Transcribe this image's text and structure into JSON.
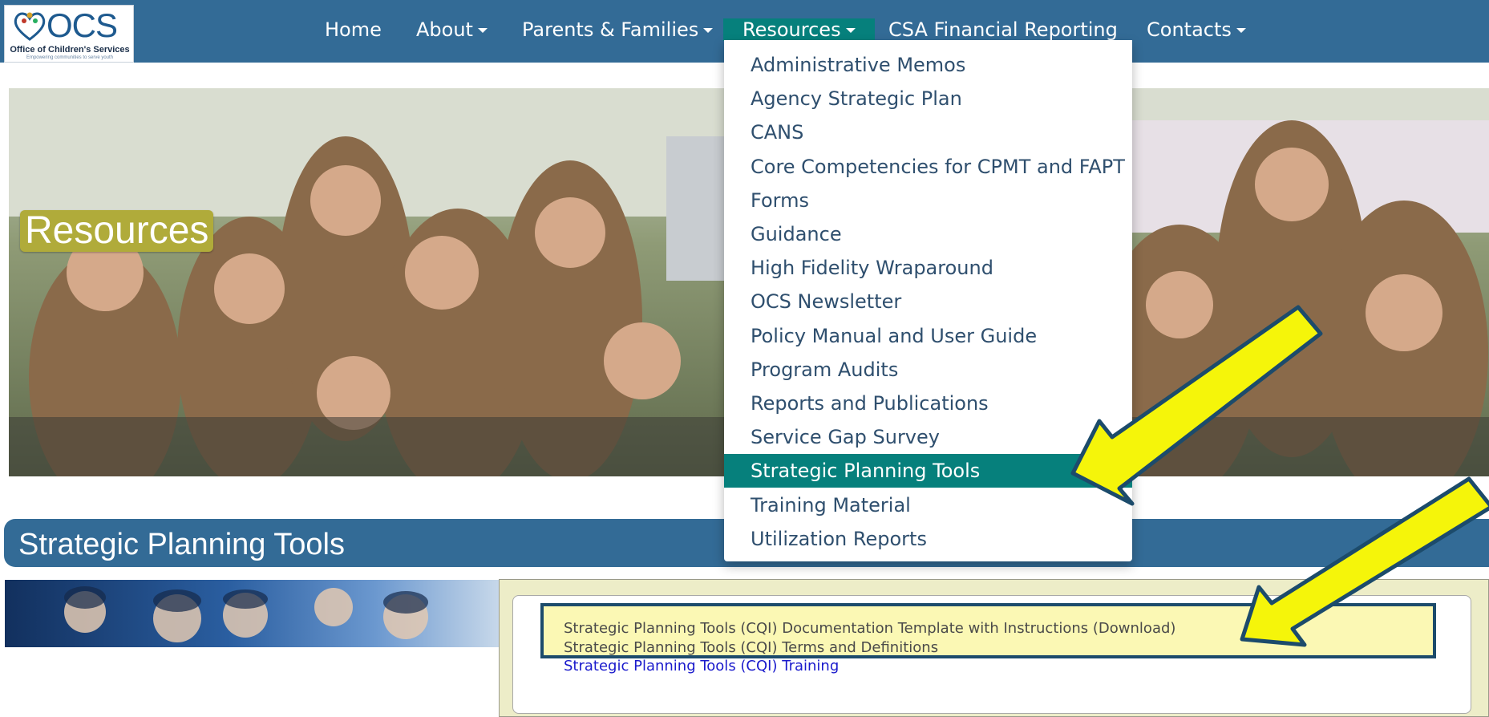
{
  "logo": {
    "name": "OCS",
    "org": "Office of Children's Services",
    "tagline": "Empowering communities to serve youth"
  },
  "nav": {
    "items": [
      {
        "label": "Home",
        "has_caret": false
      },
      {
        "label": "About",
        "has_caret": true
      },
      {
        "label": "Parents & Families",
        "has_caret": true
      },
      {
        "label": "Resources",
        "has_caret": true,
        "active": true
      },
      {
        "label": "CSA Financial Reporting",
        "has_caret": false
      },
      {
        "label": "Contacts",
        "has_caret": true
      }
    ]
  },
  "dropdown": {
    "items": [
      "Administrative Memos",
      "Agency Strategic Plan",
      "CANS",
      "Core Competencies for CPMT and FAPT",
      "Forms",
      "Guidance",
      "High Fidelity Wraparound",
      "OCS Newsletter",
      "Policy Manual and User Guide",
      "Program Audits",
      "Reports and Publications",
      "Service Gap Survey",
      "Strategic Planning Tools",
      "Training Material",
      "Utilization Reports"
    ],
    "selected": "Strategic Planning Tools"
  },
  "hero": {
    "label": "Resources"
  },
  "page": {
    "title": "Strategic Planning Tools"
  },
  "links": [
    "Strategic Planning Tools (CQI) Documentation Template with Instructions (Download)",
    "Strategic Planning Tools (CQI) Terms and Definitions",
    "Strategic Planning Tools (CQI) Training"
  ],
  "colors": {
    "nav_bg": "#336b96",
    "active_teal": "#06807c",
    "hero_label_bg": "#b0ab3a",
    "content_bg": "#ededc8",
    "highlight_bg": "#fbf8b4",
    "arrow_fill": "#f5f50a",
    "arrow_outline": "#1c4b6b",
    "link_blue": "#1a1acc"
  },
  "annotations": {
    "arrows": [
      "yellow-arrow",
      "yellow-arrow"
    ]
  }
}
